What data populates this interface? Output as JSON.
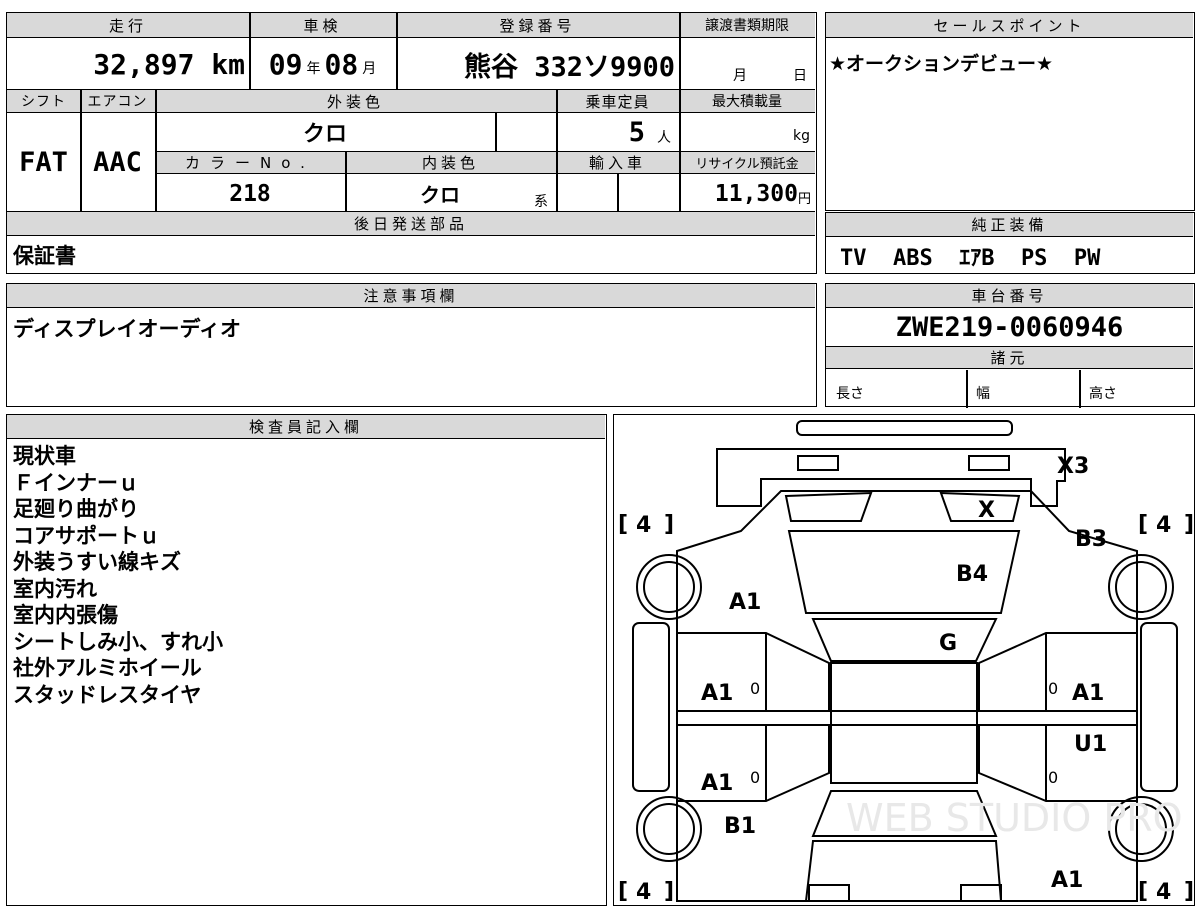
{
  "top": {
    "mileage_label": "走行",
    "shaken_label": "車検",
    "reg_label": "登録番号",
    "deadline_label": "譲渡書類期限",
    "mileage": "32,897 km",
    "shaken_year": "09",
    "shaken_year_unit": "年",
    "shaken_month": "08",
    "shaken_month_unit": "月",
    "reg_number": "熊谷 332ソ9900",
    "deadline_month": "月",
    "deadline_day": "日"
  },
  "row2": {
    "shift_label": "シフト",
    "ac_label": "エアコン",
    "ext_color_label": "外装色",
    "capacity_label": "乗車定員",
    "max_load_label": "最大積載量",
    "shift": "FAT",
    "ac": "AAC",
    "ext_color": "クロ",
    "capacity": "5",
    "capacity_unit": "人",
    "max_load_unit": "kg",
    "color_no_label": "カラーNo.",
    "int_color_label": "内装色",
    "import_label": "輸入車",
    "recycle_label": "リサイクル預託金",
    "color_no": "218",
    "int_color": "クロ",
    "int_color_suffix": "系",
    "recycle": "11,300",
    "recycle_unit": "円"
  },
  "later_parts": {
    "label": "後日発送部品",
    "value": "保証書"
  },
  "notes": {
    "label": "注意事項欄",
    "value": "ディスプレイオーディオ"
  },
  "sales": {
    "label": "セールスポイント",
    "value": "★オークションデビュー★"
  },
  "equipment": {
    "label": "純正装備",
    "value": "TV  ABS  ｴｱB  PS  PW"
  },
  "chassis": {
    "label": "車台番号",
    "value": "ZWE219-0060946"
  },
  "specs": {
    "label": "諸元",
    "length": "長さ",
    "width": "幅",
    "height": "高さ"
  },
  "inspector": {
    "label": "検査員記入欄",
    "items": [
      "現状車",
      "Ｆインナーｕ",
      "足廻り曲がり",
      "コアサポートｕ",
      "外装うすい線キズ",
      "室内汚れ",
      "室内内張傷",
      "シートしみ小、すれ小",
      "社外アルミホイール",
      "スタッドレスタイヤ"
    ]
  },
  "diagram": {
    "tire_fl": "4",
    "tire_fr": "4",
    "tire_rl": "4",
    "tire_rr": "4",
    "marks": {
      "x3": "X3",
      "x": "X",
      "b3": "B3",
      "b4": "B4",
      "a1_fender_l": "A1",
      "g": "G",
      "a1_door_fl": "A1",
      "a1_door_fr": "A1",
      "u1": "U1",
      "a1_door_rl": "A1",
      "b1": "B1",
      "a1_rear_r": "A1",
      "zero_fl": "0",
      "zero_fr": "0",
      "zero_rl": "0",
      "zero_rr": "0"
    },
    "watermark": "WEB STUDIO PRO"
  }
}
